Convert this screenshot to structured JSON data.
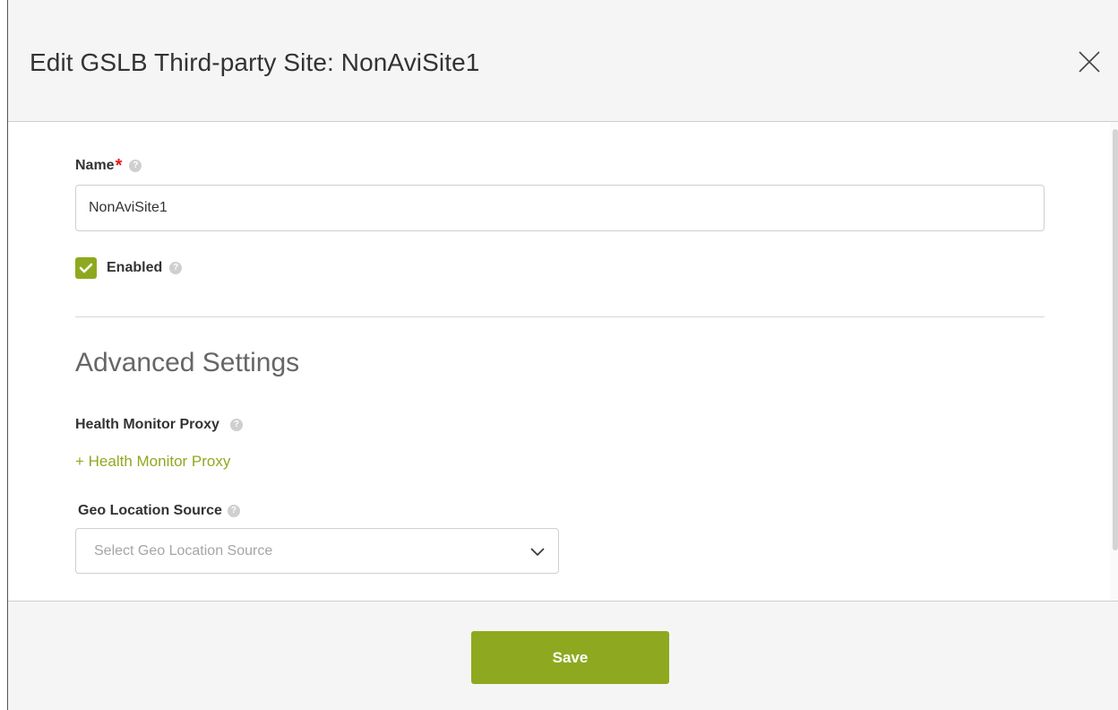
{
  "modal": {
    "title": "Edit GSLB Third-party Site: NonAviSite1"
  },
  "form": {
    "name_label": "Name",
    "required_mark": "*",
    "name_value": "NonAviSite1",
    "enabled_label": "Enabled",
    "enabled_checked": true,
    "advanced_title": "Advanced Settings",
    "health_monitor_proxy_label": "Health Monitor Proxy",
    "add_health_monitor_proxy": "+ Health Monitor Proxy",
    "geo_location_source_label": "Geo Location Source",
    "geo_location_source_placeholder": "Select Geo Location Source"
  },
  "footer": {
    "save_label": "Save"
  },
  "icons": {
    "close": "close-icon",
    "help": "help-icon",
    "check": "check-icon",
    "chevron": "chevron-down-icon"
  },
  "colors": {
    "accent": "#8ea91f",
    "required": "#e31b1b",
    "header_bg": "#f5f5f5"
  }
}
